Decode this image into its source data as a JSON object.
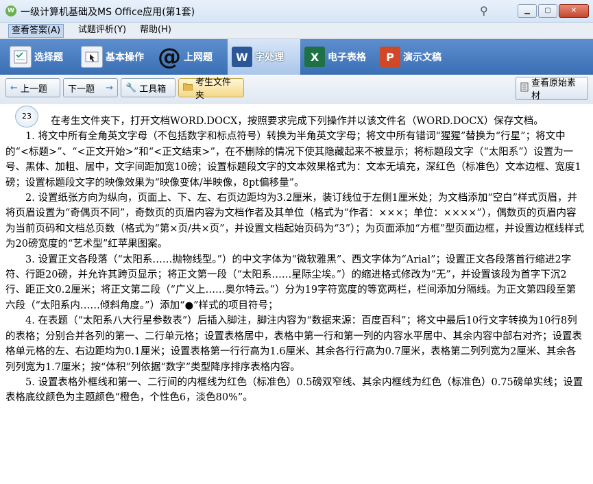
{
  "window": {
    "title": "一级计算机基础及MS Office应用(第1套)",
    "app_icon_text": "W"
  },
  "menu": [
    {
      "label": "查看答案(A)"
    },
    {
      "label": "试题评析(Y)"
    },
    {
      "label": "帮助(H)"
    }
  ],
  "categories": [
    {
      "label": "选择题",
      "icon": "checklist-icon"
    },
    {
      "label": "基本操作",
      "icon": "mouse-cursor-icon"
    },
    {
      "label": "上网题",
      "icon": "at-sign-icon"
    },
    {
      "label": "字处理",
      "icon": "word-icon"
    },
    {
      "label": "电子表格",
      "icon": "excel-icon"
    },
    {
      "label": "演示文稿",
      "icon": "powerpoint-icon"
    }
  ],
  "nav": {
    "prev": "上一题",
    "next": "下一题",
    "toolbox": "工具箱",
    "exam_folder": "考生文件夹",
    "view_source": "查看原始素材"
  },
  "question": {
    "number": "23",
    "intro": "在考生文件夹下，打开文档WORD.DOCX，按照要求完成下列操作并以该文件名（WORD.DOCX）保存文档。",
    "items": [
      "1. 将文中所有全角英文字母（不包括数字和标点符号）转换为半角英文字母；将文中所有错词“猩猩”替换为“行星”；将文中的“<标题>”、“<正文开始>”和“<正文结束>”，在不删除的情况下使其隐藏起来不被显示；将标题段文字（“太阳系”）设置为一号、黑体、加粗、居中，文字间距加宽10磅；设置标题段文字的文本效果格式为：文本无填充，深红色（标准色）文本边框、宽度1磅；设置标题段文字的映像效果为“映像变体/半映像，8pt偏移量”。",
      "2. 设置纸张方向为纵向，页面上、下、左、右页边距均为3.2厘米，装订线位于左侧1厘米处；为文档添加“空白”样式页眉，并将页眉设置为“奇偶页不同”，奇数页的页眉内容为文档作者及其单位（格式为“作者：×××；单位：××××”），偶数页的页眉内容为当前页码和文档总页数（格式为“第×页/共×页”，并设置文档起始页码为“3”）；为页面添加“方框”型页面边框，并设置边框线样式为20磅宽度的“艺术型”红苹果图案。",
      "3. 设置正文各段落（“太阳系……抛物线型。”）的中文字体为“微软雅黑”、西文字体为“Arial”；设置正文各段落首行缩进2字符、行距20磅，并允许其跨页显示；将正文第一段（“太阳系……星际尘埃。”）的缩进格式修改为“无”，并设置该段为首字下沉2行、距正文0.2厘米；将正文第二段（“广义上……奥尔特云。”）分为19字符宽度的等宽两栏，栏间添加分隔线。为正文第四段至第六段（“太阳系内……倾斜角度。”）添加“●”样式的项目符号；",
      "4. 在表题（“太阳系八大行星参数表”）后插入脚注，脚注内容为“数据来源：百度百科”；将文中最后10行文字转换为10行8列的表格；分别合并各列的第一、二行单元格；设置表格居中，表格中第一行和第一列的内容水平居中、其余内容中部右对齐；设置表格单元格的左、右边距均为0.1厘米；设置表格第一行行高为1.6厘米、其余各行行高为0.7厘米，表格第二列列宽为2厘米、其余各列列宽为1.7厘米；按“体积”列依据“数字”类型降序排序表格内容。",
      "5. 设置表格外框线和第一、二行间的内框线为红色（标准色）0.5磅双窄线、其余内框线为红色（标准色）0.75磅单实线；设置表格底纹颜色为主题颜色“橙色，个性色6，淡色80%”。"
    ]
  }
}
